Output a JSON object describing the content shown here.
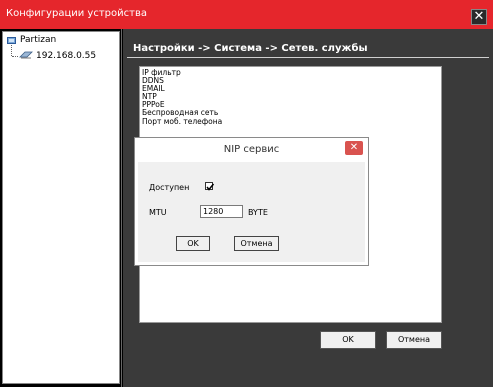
{
  "window": {
    "title": "Конфигурации устройства",
    "close_glyph": "✕"
  },
  "tree": {
    "root_label": "Partizan",
    "root_icon": "network-folder-icon",
    "child_label": "192.168.0.55",
    "child_icon": "device-icon"
  },
  "breadcrumb": "Настройки -> Система -> Сетев. службы",
  "services": {
    "items": [
      "IP фильтр",
      "DDNS",
      "EMAIL",
      "NTP",
      "PPPoE",
      "Беспроводная сеть",
      "Порт моб. телефона"
    ]
  },
  "buttons": {
    "ok": "OK",
    "cancel": "Отмена"
  },
  "dialog": {
    "title": "NIP сервис",
    "close_glyph": "✕",
    "enabled_label": "Доступен",
    "enabled_checked": true,
    "mtu_label": "MTU",
    "mtu_value": "1280",
    "mtu_unit": "BYTE",
    "ok": "OK",
    "cancel": "Отмена"
  },
  "colors": {
    "titlebar": "#e5262c",
    "panel": "#3a3a3a",
    "dialog_close": "#d9534f"
  }
}
